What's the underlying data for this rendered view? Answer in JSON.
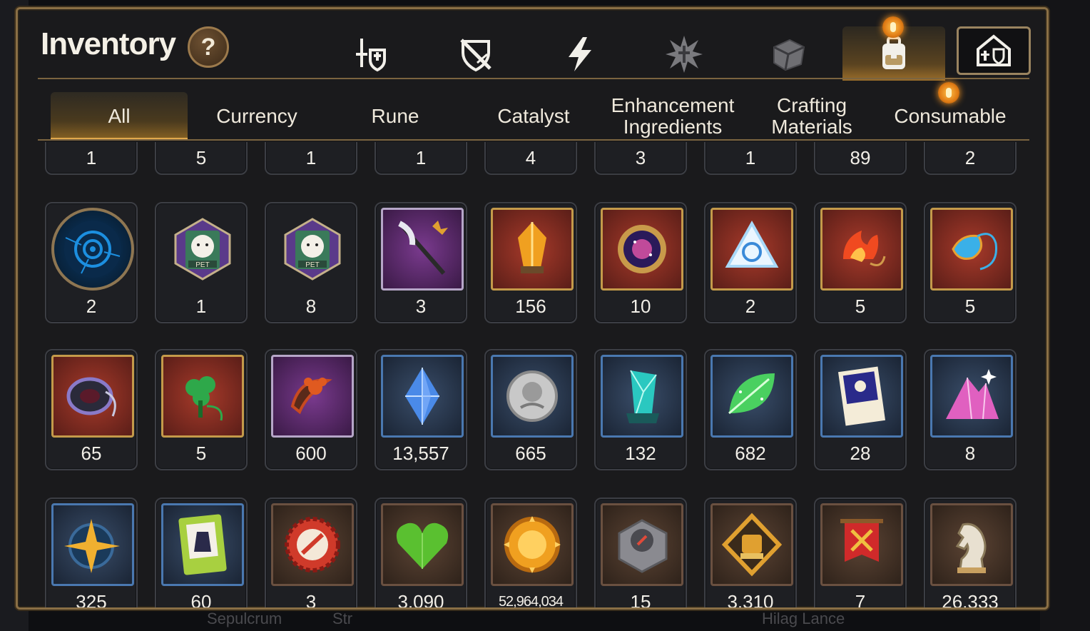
{
  "header": {
    "title": "Inventory",
    "help_label": "?"
  },
  "top_nav": [
    {
      "name": "equipment-icon",
      "active": false
    },
    {
      "name": "broken-shield-icon",
      "active": false
    },
    {
      "name": "lightning-icon",
      "active": false
    },
    {
      "name": "starburst-icon",
      "active": false
    },
    {
      "name": "cube-icon",
      "active": false
    },
    {
      "name": "backpack-icon",
      "active": true,
      "notification": true
    },
    {
      "name": "storage-icon",
      "active": false
    }
  ],
  "tabs": [
    {
      "label": "All",
      "active": true
    },
    {
      "label": "Currency",
      "active": false
    },
    {
      "label": "Rune",
      "active": false
    },
    {
      "label": "Catalyst",
      "active": false
    },
    {
      "label": "Enhancement Ingredients",
      "active": false
    },
    {
      "label": "Crafting Materials",
      "active": false
    },
    {
      "label": "Consumable",
      "active": false,
      "notification": true
    }
  ],
  "rows": [
    {
      "counts": [
        "1",
        "5",
        "1",
        "1",
        "4",
        "3",
        "1",
        "89",
        "2"
      ]
    },
    {
      "items": [
        {
          "icon": "blue-rune-orb-icon",
          "count": "2",
          "frame": "circle",
          "color": "#1c8fe0"
        },
        {
          "icon": "pet-badge-icon",
          "count": "1",
          "frame": "hex",
          "color": "#5a3a8a"
        },
        {
          "icon": "pet-badge-icon",
          "count": "8",
          "frame": "hex",
          "color": "#5a3a8a"
        },
        {
          "icon": "staff-icon",
          "count": "3",
          "frame": "purple",
          "color": "#e0a030"
        },
        {
          "icon": "amber-crystal-icon",
          "count": "156",
          "frame": "red",
          "color": "#f0a020"
        },
        {
          "icon": "cosmic-disc-icon",
          "count": "10",
          "frame": "red",
          "color": "#c04a9a"
        },
        {
          "icon": "tetrahedron-icon",
          "count": "2",
          "frame": "red",
          "color": "#a8d8f8"
        },
        {
          "icon": "fire-charm-icon",
          "count": "5",
          "frame": "red",
          "color": "#f04a20"
        },
        {
          "icon": "water-charm-icon",
          "count": "5",
          "frame": "red",
          "color": "#3ab0e8"
        }
      ]
    },
    {
      "items": [
        {
          "icon": "ring-charm-icon",
          "count": "65",
          "frame": "red",
          "color": "#8a7ac8"
        },
        {
          "icon": "clover-charm-icon",
          "count": "5",
          "frame": "red",
          "color": "#2ea84a"
        },
        {
          "icon": "flower-ring-icon",
          "count": "600",
          "frame": "purple",
          "color": "#e05a20"
        },
        {
          "icon": "blue-gem-icon",
          "count": "13,557",
          "frame": "blue",
          "color": "#4a8ae8"
        },
        {
          "icon": "silver-coin-icon",
          "count": "665",
          "frame": "blue",
          "color": "#c8c8c8"
        },
        {
          "icon": "teal-crystal-icon",
          "count": "132",
          "frame": "blue",
          "color": "#2ac8c0"
        },
        {
          "icon": "green-leaf-icon",
          "count": "682",
          "frame": "blue",
          "color": "#4ad060"
        },
        {
          "icon": "scroll-card-icon",
          "count": "28",
          "frame": "blue",
          "color": "#2a2a8a"
        },
        {
          "icon": "pink-crystal-pile-icon",
          "count": "8",
          "frame": "blue",
          "color": "#e060c0"
        }
      ]
    },
    {
      "items": [
        {
          "icon": "star-compass-icon",
          "count": "325",
          "frame": "blue",
          "color": "#f0b030"
        },
        {
          "icon": "costume-card-icon",
          "count": "60",
          "frame": "blue",
          "color": "#a8d040"
        },
        {
          "icon": "bottle-cap-icon",
          "count": "3",
          "frame": "brown",
          "color": "#d03a2a"
        },
        {
          "icon": "green-heart-icon",
          "count": "3,090",
          "frame": "brown",
          "color": "#5ac030"
        },
        {
          "icon": "gold-coin-icon",
          "count": "52,964,034",
          "frame": "brown",
          "color": "#f0a020"
        },
        {
          "icon": "stone-compass-icon",
          "count": "15",
          "frame": "brown",
          "color": "#8a8a90"
        },
        {
          "icon": "fist-emblem-icon",
          "count": "3,310",
          "frame": "brown",
          "color": "#e0a030"
        },
        {
          "icon": "banner-icon",
          "count": "7",
          "frame": "brown",
          "color": "#d02a2a"
        },
        {
          "icon": "chess-knight-icon",
          "count": "26,333",
          "frame": "brown",
          "color": "#e8e0d0"
        }
      ]
    }
  ],
  "background_text": {
    "left": "Sepulcrum",
    "middle": "Str",
    "right": "Hilag Lance"
  }
}
